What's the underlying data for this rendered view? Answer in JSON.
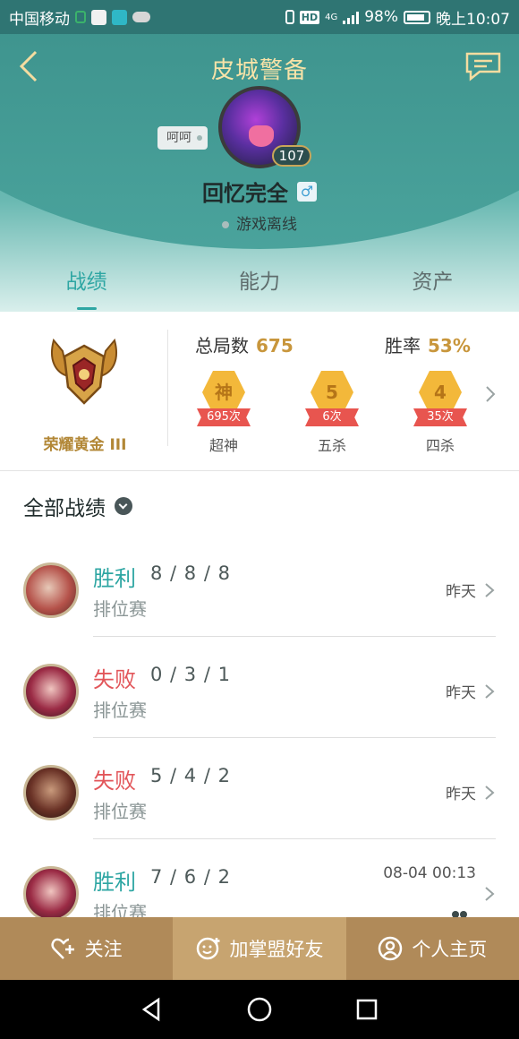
{
  "status_bar": {
    "carrier": "中国移动",
    "battery": "98%",
    "time": "晚上10:07",
    "hd": "HD",
    "net": "4G"
  },
  "header": {
    "title": "皮城警备",
    "nickname_tag": "呵呵",
    "level": "107",
    "player_name": "回忆完全",
    "gender_symbol": "♂",
    "online_status": "游戏离线"
  },
  "tabs": [
    {
      "label": "战绩",
      "active": true
    },
    {
      "label": "能力",
      "active": false
    },
    {
      "label": "资产",
      "active": false
    }
  ],
  "summary": {
    "rank_name": "荣耀黄金 III",
    "total_label": "总局数",
    "total_value": "675",
    "winrate_label": "胜率",
    "winrate_value": "53%",
    "medals": [
      {
        "glyph": "神",
        "count": "695次",
        "label": "超神"
      },
      {
        "glyph": "5",
        "count": "6次",
        "label": "五杀"
      },
      {
        "glyph": "4",
        "count": "35次",
        "label": "四杀"
      }
    ]
  },
  "list": {
    "title": "全部战绩",
    "matches": [
      {
        "result": "胜利",
        "kda": "8 / 8 / 8",
        "mode": "排位赛",
        "time": "昨天",
        "win": true
      },
      {
        "result": "失败",
        "kda": "0 / 3 / 1",
        "mode": "排位赛",
        "time": "昨天",
        "win": false
      },
      {
        "result": "失败",
        "kda": "5 / 4 / 2",
        "mode": "排位赛",
        "time": "昨天",
        "win": false
      },
      {
        "result": "胜利",
        "kda": "7 / 6 / 2",
        "mode": "排位赛",
        "time": "08-04 00:13",
        "win": true
      }
    ]
  },
  "actions": {
    "follow": "关注",
    "add_friend": "加掌盟好友",
    "homepage": "个人主页"
  },
  "colors": {
    "accent": "#2ea6a3",
    "lose": "#e2565a",
    "gold": "#c8963c",
    "action_bar": "#b08a59"
  }
}
